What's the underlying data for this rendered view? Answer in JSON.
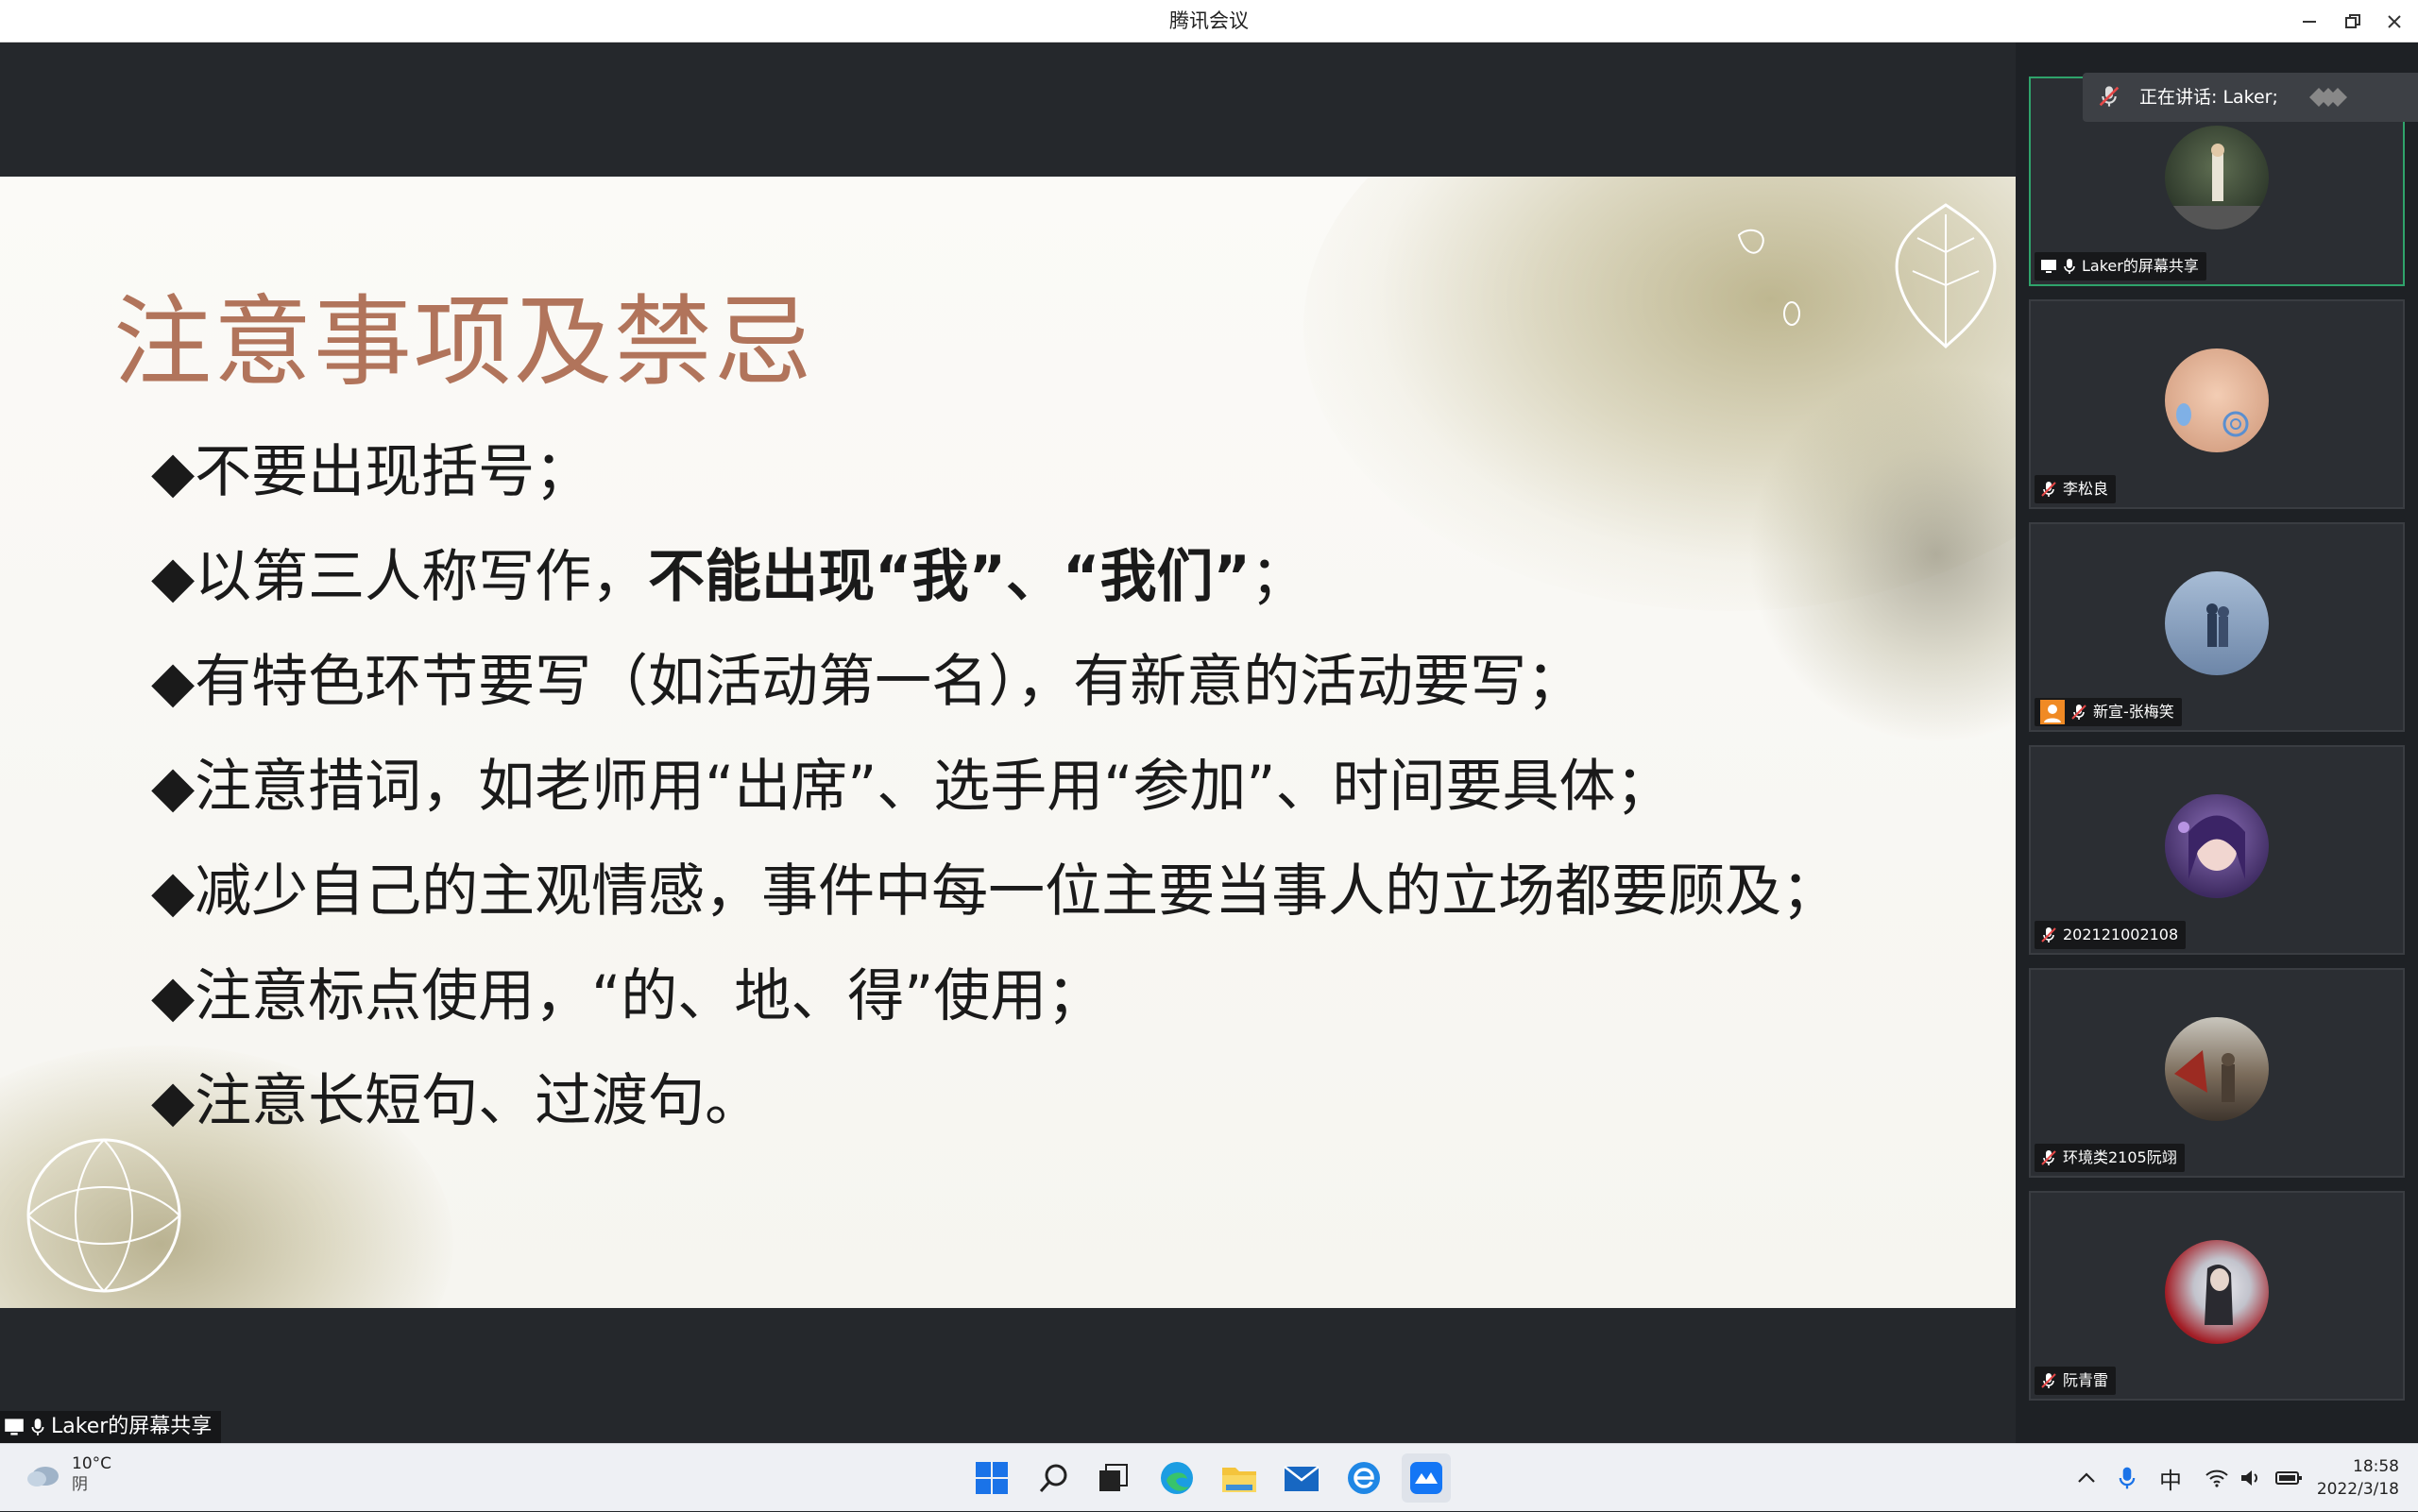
{
  "window": {
    "title": "腾讯会议",
    "minimize_icon": "minimize-icon",
    "restore_icon": "restore-icon",
    "close_icon": "close-icon"
  },
  "slide": {
    "title": "注意事项及禁忌",
    "bullets": [
      {
        "text": "◆不要出现括号；"
      },
      {
        "text": "◆以第三人称写作，",
        "bold": "不能出现“我”、“我们”",
        "after": "；"
      },
      {
        "text": "◆有特色环节要写（如活动第一名），有新意的活动要写；"
      },
      {
        "text": "◆注意措词，如老师用“出席”、选手用“参加”、时间要具体；"
      },
      {
        "text": "◆减少自己的主观情感，事件中每一位主要当事人的立场都要顾及；"
      },
      {
        "text": "◆注意标点使用，“的、地、得”使用；"
      },
      {
        "text": "◆注意长短句、过渡句。"
      }
    ]
  },
  "speaking": {
    "label": "正在讲话: Laker;"
  },
  "participants": [
    {
      "name": "Laker的屏幕共享",
      "active": true,
      "mic": "on",
      "avatar_color": "#3d4a3a"
    },
    {
      "name": "李松良",
      "active": false,
      "mic": "off",
      "avatar_color": "#e8b59a"
    },
    {
      "name": "新宣-张梅笑",
      "active": false,
      "mic": "off",
      "avatar_color": "#7f95b0"
    },
    {
      "name": "202121002108",
      "active": false,
      "mic": "off",
      "avatar_color": "#5a3f86"
    },
    {
      "name": "环境类2105阮翊",
      "active": false,
      "mic": "off",
      "avatar_color": "#6b5b4a"
    },
    {
      "name": "阮青雷",
      "active": false,
      "mic": "off",
      "avatar_color": "#b0303a"
    }
  ],
  "share_label": "Laker的屏幕共享",
  "taskbar": {
    "weather_temp": "10°C",
    "weather_cond": "阴",
    "ime": "中",
    "time": "18:58",
    "date": "2022/3/18"
  }
}
